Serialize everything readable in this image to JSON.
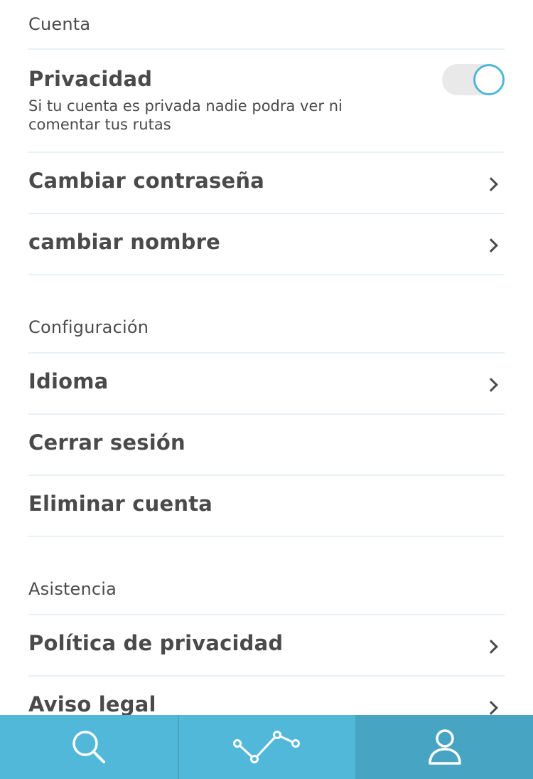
{
  "sections": {
    "account": {
      "title": "Cuenta",
      "privacy": {
        "label": "Privacidad",
        "description": "Si tu cuenta es privada nadie podra ver ni comentar tus rutas",
        "enabled": true
      },
      "change_password": "Cambiar contraseña",
      "change_name": "cambiar nombre"
    },
    "settings": {
      "title": "Configuración",
      "language": "Idioma",
      "logout": "Cerrar sesión",
      "delete_account": "Eliminar cuenta"
    },
    "support": {
      "title": "Asistencia",
      "privacy_policy": "Política de privacidad",
      "legal_notice": "Aviso legal"
    }
  },
  "tabbar": {
    "tabs": [
      {
        "icon": "search-icon",
        "active": false
      },
      {
        "icon": "route-chart-icon",
        "active": false
      },
      {
        "icon": "user-icon",
        "active": true
      }
    ]
  },
  "colors": {
    "accent": "#52b8da",
    "accent_active": "#48a4c3",
    "toggle_border": "#4fb7d6",
    "divider": "#e6f2f3",
    "text": "#4a4a4a"
  }
}
